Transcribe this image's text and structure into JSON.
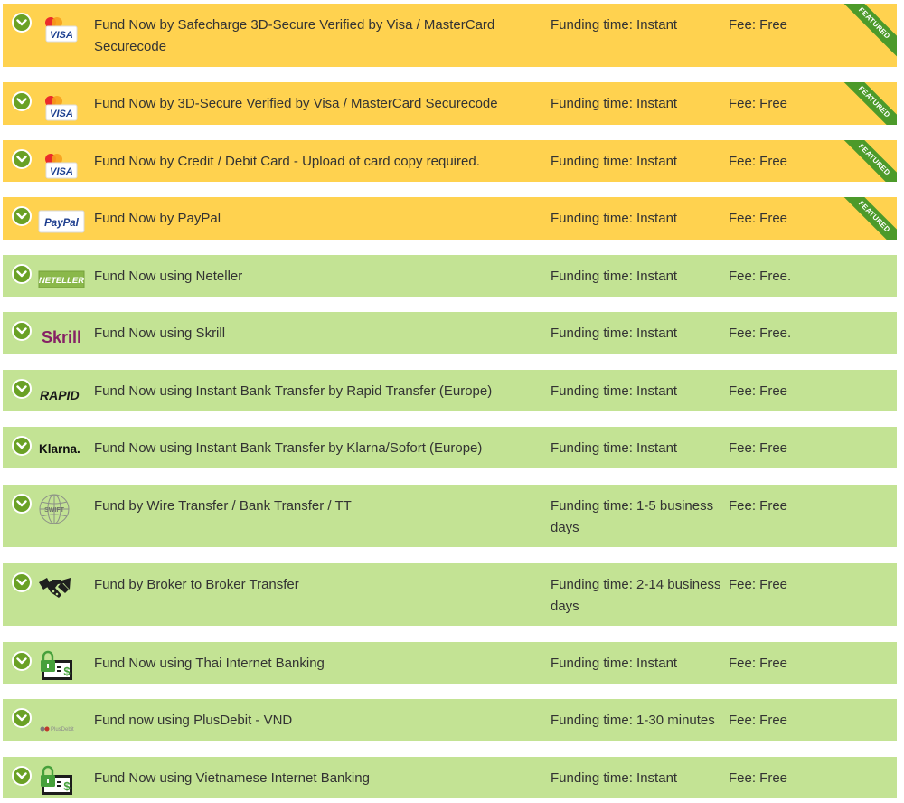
{
  "featured_label": "FEATURED",
  "colors": {
    "featured_row": "#ffd24f",
    "standard_row": "#c3e394",
    "chevron": "#6aa125",
    "ribbon": "#4c9a2a"
  },
  "methods": [
    {
      "name": "Fund Now by Safecharge 3D-Secure Verified by Visa / MasterCard Securecode",
      "funding_time": "Funding time: Instant",
      "fee": "Fee: Free",
      "featured": true,
      "logo": "visa-mastercard-icon"
    },
    {
      "name": "Fund Now by 3D-Secure Verified by Visa / MasterCard Securecode",
      "funding_time": "Funding time: Instant",
      "fee": "Fee: Free",
      "featured": true,
      "logo": "visa-mastercard-icon"
    },
    {
      "name": "Fund Now by Credit / Debit Card - Upload of card copy required.",
      "funding_time": "Funding time: Instant",
      "fee": "Fee: Free",
      "featured": true,
      "logo": "visa-mastercard-icon"
    },
    {
      "name": "Fund Now by PayPal",
      "funding_time": "Funding time: Instant",
      "fee": "Fee: Free",
      "featured": true,
      "logo": "paypal-icon",
      "logo_text": "PayPal"
    },
    {
      "name": "Fund Now using Neteller",
      "funding_time": "Funding time: Instant",
      "fee": "Fee: Free.",
      "featured": false,
      "logo": "neteller-icon",
      "logo_text": "NETELLER"
    },
    {
      "name": "Fund Now using Skrill",
      "funding_time": "Funding time: Instant",
      "fee": "Fee: Free.",
      "featured": false,
      "logo": "skrill-icon",
      "logo_text": "Skrill"
    },
    {
      "name": "Fund Now using Instant Bank Transfer by Rapid Transfer (Europe)",
      "funding_time": "Funding time: Instant",
      "fee": "Fee: Free",
      "featured": false,
      "logo": "rapid-transfer-icon",
      "logo_text": "RAPID"
    },
    {
      "name": "Fund Now using Instant Bank Transfer by Klarna/Sofort (Europe)",
      "funding_time": "Funding time: Instant",
      "fee": "Fee: Free",
      "featured": false,
      "logo": "klarna-icon",
      "logo_text": "Klarna."
    },
    {
      "name": "Fund by Wire Transfer / Bank Transfer / TT",
      "funding_time": "Funding time: 1-5 business days",
      "fee": "Fee: Free",
      "featured": false,
      "logo": "swift-globe-icon",
      "logo_text": "SWIFT"
    },
    {
      "name": "Fund by Broker to Broker Transfer",
      "funding_time": "Funding time: 2-14 business days",
      "fee": "Fee: Free",
      "featured": false,
      "logo": "handshake-icon"
    },
    {
      "name": "Fund Now using Thai Internet Banking",
      "funding_time": "Funding time: Instant",
      "fee": "Fee: Free",
      "featured": false,
      "logo": "internet-banking-icon"
    },
    {
      "name": "Fund now using PlusDebit - VND",
      "funding_time": "Funding time: 1-30 minutes",
      "fee": "Fee: Free",
      "featured": false,
      "logo": "plusdebit-icon",
      "logo_text": "PlusDebit"
    },
    {
      "name": "Fund Now using Vietnamese Internet Banking",
      "funding_time": "Funding time: Instant",
      "fee": "Fee: Free",
      "featured": false,
      "logo": "internet-banking-icon"
    }
  ]
}
